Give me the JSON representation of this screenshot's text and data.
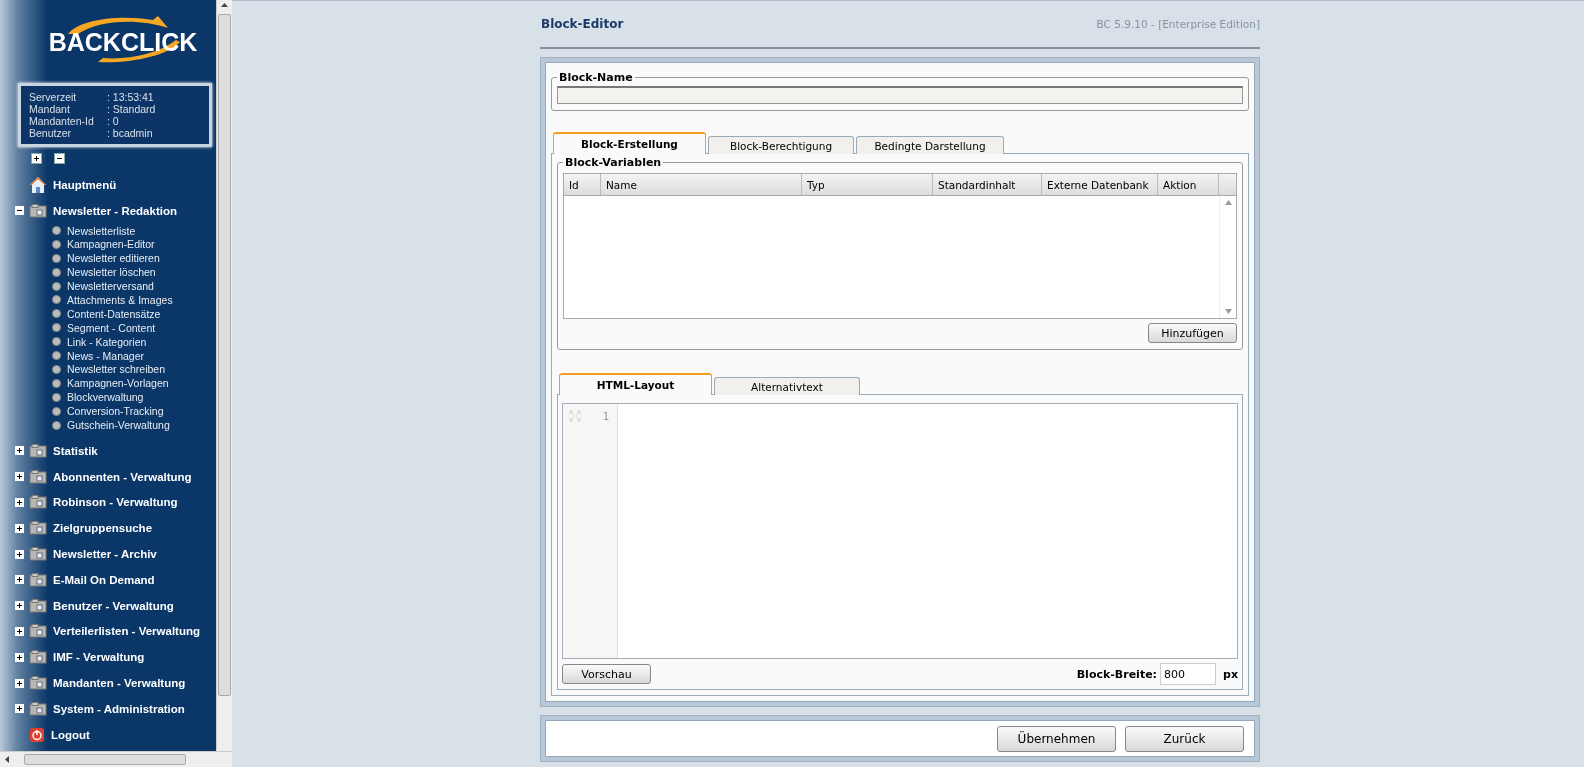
{
  "logo": {
    "text": "BACKCLICK"
  },
  "server_info": [
    {
      "label": "Serverzeit",
      "value": ": 13:53:41"
    },
    {
      "label": "Mandant",
      "value": ": Standard"
    },
    {
      "label": "Mandanten-Id",
      "value": ": 0"
    },
    {
      "label": "Benutzer",
      "value": ": bcadmin"
    }
  ],
  "menu": [
    {
      "kind": "home",
      "label": "Hauptmenü"
    },
    {
      "kind": "folder",
      "label": "Newsletter - Redaktion",
      "expanded": true,
      "children": [
        "Newsletterliste",
        "Kampagnen-Editor",
        "Newsletter editieren",
        "Newsletter löschen",
        "Newsletterversand",
        "Attachments & Images",
        "Content-Datensätze",
        "Segment - Content",
        "Link - Kategorien",
        "News - Manager",
        "Newsletter schreiben",
        "Kampagnen-Vorlagen",
        "Blockverwaltung",
        "Conversion-Tracking",
        "Gutschein-Verwaltung"
      ]
    },
    {
      "kind": "folder",
      "label": "Statistik",
      "expanded": false
    },
    {
      "kind": "folder",
      "label": "Abonnenten - Verwaltung",
      "expanded": false
    },
    {
      "kind": "folder",
      "label": "Robinson - Verwaltung",
      "expanded": false
    },
    {
      "kind": "folder",
      "label": "Zielgruppensuche",
      "expanded": false
    },
    {
      "kind": "folder",
      "label": "Newsletter - Archiv",
      "expanded": false
    },
    {
      "kind": "folder",
      "label": "E-Mail On Demand",
      "expanded": false
    },
    {
      "kind": "folder",
      "label": "Benutzer - Verwaltung",
      "expanded": false
    },
    {
      "kind": "folder",
      "label": "Verteilerlisten - Verwaltung",
      "expanded": false
    },
    {
      "kind": "folder",
      "label": "IMF - Verwaltung",
      "expanded": false
    },
    {
      "kind": "folder",
      "label": "Mandanten - Verwaltung",
      "expanded": false
    },
    {
      "kind": "folder",
      "label": "System - Administration",
      "expanded": false
    },
    {
      "kind": "logout",
      "label": "Logout"
    }
  ],
  "page": {
    "title": "Block-Editor",
    "version": "BC 5.9.10 - [Enterprise Edition]"
  },
  "block_name": {
    "legend": "Block-Name"
  },
  "tabs": [
    {
      "label": "Block-Erstellung",
      "selected": true
    },
    {
      "label": "Block-Berechtigung",
      "selected": false
    },
    {
      "label": "Bedingte Darstellung",
      "selected": false
    }
  ],
  "variables": {
    "legend": "Block-Variablen",
    "columns": [
      "Id",
      "Name",
      "Typ",
      "Standardinhalt",
      "Externe Datenbank",
      "Aktion"
    ],
    "add_button": "Hinzufügen"
  },
  "editor_tabs": [
    {
      "label": "HTML-Layout",
      "selected": true
    },
    {
      "label": "Alternativtext",
      "selected": false
    }
  ],
  "editor": {
    "line_numbers": [
      "1"
    ],
    "preview_button": "Vorschau",
    "width_label": "Block-Breite:",
    "width_value": "800",
    "width_unit": "px"
  },
  "buttons": [
    "Übernehmen",
    "Zurück"
  ]
}
